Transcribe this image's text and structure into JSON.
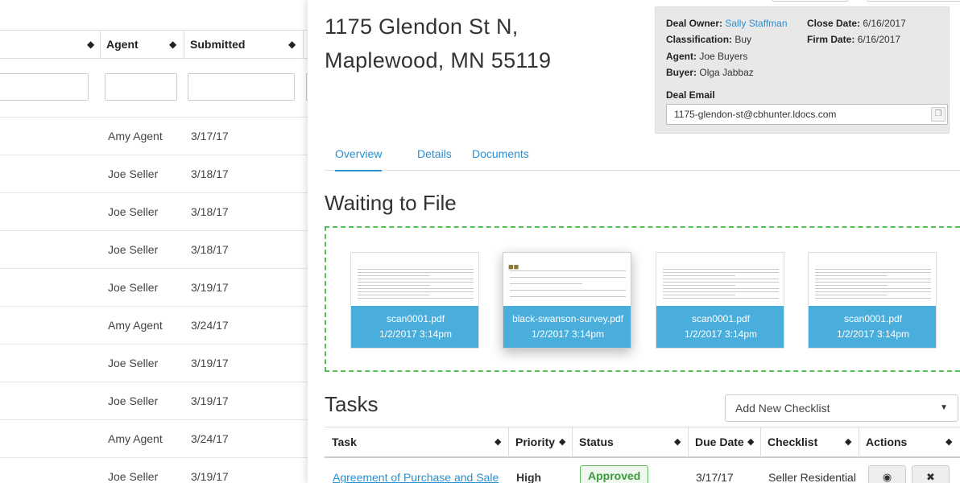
{
  "list": {
    "columns": [
      {
        "label": ""
      },
      {
        "label": "Agent"
      },
      {
        "label": "Submitted"
      }
    ],
    "rows": [
      {
        "agent": "Amy Agent",
        "submitted": "3/17/17"
      },
      {
        "agent": "Joe Seller",
        "submitted": "3/18/17"
      },
      {
        "agent": "Joe Seller",
        "submitted": "3/18/17"
      },
      {
        "agent": "Joe Seller",
        "submitted": "3/18/17"
      },
      {
        "agent": "Joe Seller",
        "submitted": "3/19/17"
      },
      {
        "agent": "Amy Agent",
        "submitted": "3/24/17"
      },
      {
        "agent": "Joe Seller",
        "submitted": "3/19/17"
      },
      {
        "agent": "Joe Seller",
        "submitted": "3/19/17"
      },
      {
        "agent": "Amy Agent",
        "submitted": "3/24/17"
      },
      {
        "agent": "Joe Seller",
        "submitted": "3/19/17"
      }
    ]
  },
  "deal": {
    "address_line1": "1175 Glendon St N,",
    "address_line2": "Maplewood, MN 55119",
    "owner_label": "Deal Owner:",
    "owner_value": "Sally Staffman",
    "close_label": "Close Date:",
    "close_value": "6/16/2017",
    "classification_label": "Classification:",
    "classification_value": "Buy",
    "firm_label": "Firm Date:",
    "firm_value": "6/16/2017",
    "agent_label": "Agent:",
    "agent_value": "Joe Buyers",
    "buyer_label": "Buyer:",
    "buyer_value": "Olga Jabbaz",
    "email_label": "Deal Email",
    "email_value": "1175-glendon-st@cbhunter.ldocs.com"
  },
  "tabs": [
    {
      "label": "Overview"
    },
    {
      "label": "Details"
    },
    {
      "label": "Documents"
    }
  ],
  "waiting": {
    "title": "Waiting to File",
    "files": [
      {
        "name": "scan0001.pdf",
        "date": "1/2/2017 3:14pm"
      },
      {
        "name": "black-swanson-survey.pdf",
        "date": "1/2/2017 3:14pm"
      },
      {
        "name": "scan0001.pdf",
        "date": "1/2/2017 3:14pm"
      },
      {
        "name": "scan0001.pdf",
        "date": "1/2/2017 3:14pm"
      }
    ]
  },
  "tasks": {
    "title": "Tasks",
    "add_checklist": "Add New Checklist",
    "columns": [
      {
        "label": "Task"
      },
      {
        "label": "Priority"
      },
      {
        "label": "Status"
      },
      {
        "label": "Due Date"
      },
      {
        "label": "Checklist"
      },
      {
        "label": "Actions"
      }
    ],
    "row": {
      "task": "Agreement of Purchase and Sale",
      "priority": "High",
      "status": "Approved",
      "due": "3/17/17",
      "checklist": "Seller Residential"
    }
  },
  "colors": {
    "accent": "#2a8fd0",
    "card_caption": "#4aaedc",
    "dropzone": "#55c155",
    "approved": "#5cb85c"
  },
  "icons": [
    "sort-icon",
    "copy-icon",
    "caret-down-icon",
    "eye-icon",
    "trash-icon"
  ]
}
